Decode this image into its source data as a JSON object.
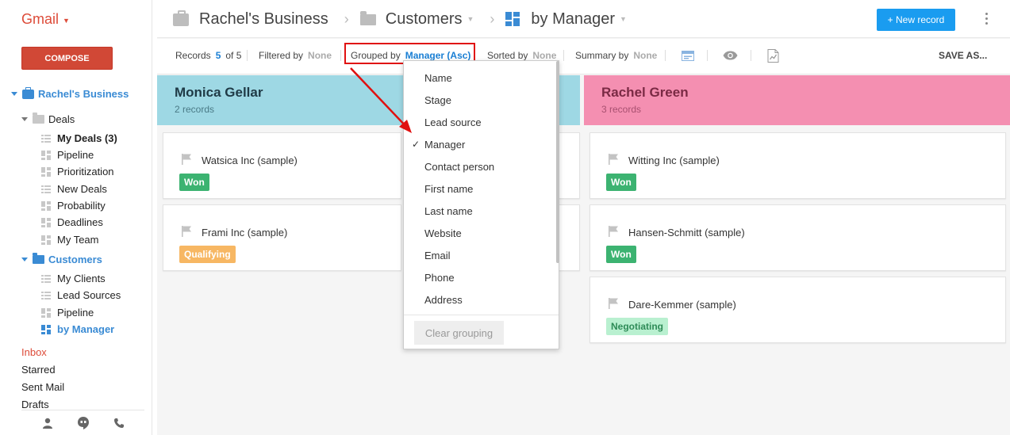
{
  "gmail": {
    "logo": "Gmail",
    "compose": "COMPOSE"
  },
  "sidebar": {
    "business": "Rachel's Business",
    "deals": {
      "label": "Deals",
      "items": [
        {
          "label": "My Deals (3)",
          "icon": "list-icon"
        },
        {
          "label": "Pipeline",
          "icon": "board-icon"
        },
        {
          "label": "Prioritization",
          "icon": "board-icon"
        },
        {
          "label": "New Deals",
          "icon": "list-icon"
        },
        {
          "label": "Probability",
          "icon": "board-icon"
        },
        {
          "label": "Deadlines",
          "icon": "board-icon"
        },
        {
          "label": "My Team",
          "icon": "board-icon"
        }
      ]
    },
    "customers": {
      "label": "Customers",
      "items": [
        {
          "label": "My Clients",
          "icon": "list-icon"
        },
        {
          "label": "Lead Sources",
          "icon": "list-icon"
        },
        {
          "label": "Pipeline",
          "icon": "board-icon"
        },
        {
          "label": "by Manager",
          "icon": "board-icon"
        }
      ]
    },
    "mail": [
      "Inbox",
      "Starred",
      "Sent Mail",
      "Drafts"
    ]
  },
  "header": {
    "crumbs": [
      "Rachel's Business",
      "Customers",
      "by Manager"
    ],
    "new_record": "+ New record"
  },
  "toolbar": {
    "records_label": "Records",
    "records_shown": "5",
    "records_of": "of 5",
    "filtered_label": "Filtered by",
    "filtered_value": "None",
    "grouped_label": "Grouped by",
    "grouped_value": "Manager (Asc)",
    "sorted_label": "Sorted by",
    "sorted_value": "None",
    "summary_label": "Summary by",
    "summary_value": "None",
    "save_as": "SAVE AS..."
  },
  "groups": [
    {
      "name": "Monica Gellar",
      "count": "2 records",
      "color": "#9ed8e4",
      "cards": [
        {
          "title": "Watsica Inc (sample)",
          "stage": "Won",
          "stage_color": "#3cb371"
        },
        {
          "title": "Frami Inc (sample)",
          "stage": "Qualifying",
          "stage_color": "#f7b763"
        }
      ]
    },
    {
      "name": "Rachel Green",
      "count": "3 records",
      "color": "#f48fb1",
      "cards": [
        {
          "title": "Witting Inc (sample)",
          "stage": "Won",
          "stage_color": "#3cb371"
        },
        {
          "title": "Hansen-Schmitt (sample)",
          "stage": "Won",
          "stage_color": "#3cb371"
        },
        {
          "title": "Dare-Kemmer (sample)",
          "stage": "Negotiating",
          "stage_color": "#b9f0d0"
        }
      ]
    }
  ],
  "group_menu": {
    "options": [
      "Name",
      "Stage",
      "Lead source",
      "Manager",
      "Contact person",
      "First name",
      "Last name",
      "Website",
      "Email",
      "Phone",
      "Address"
    ],
    "selected": "Manager",
    "check": "✓",
    "clear": "Clear grouping"
  }
}
